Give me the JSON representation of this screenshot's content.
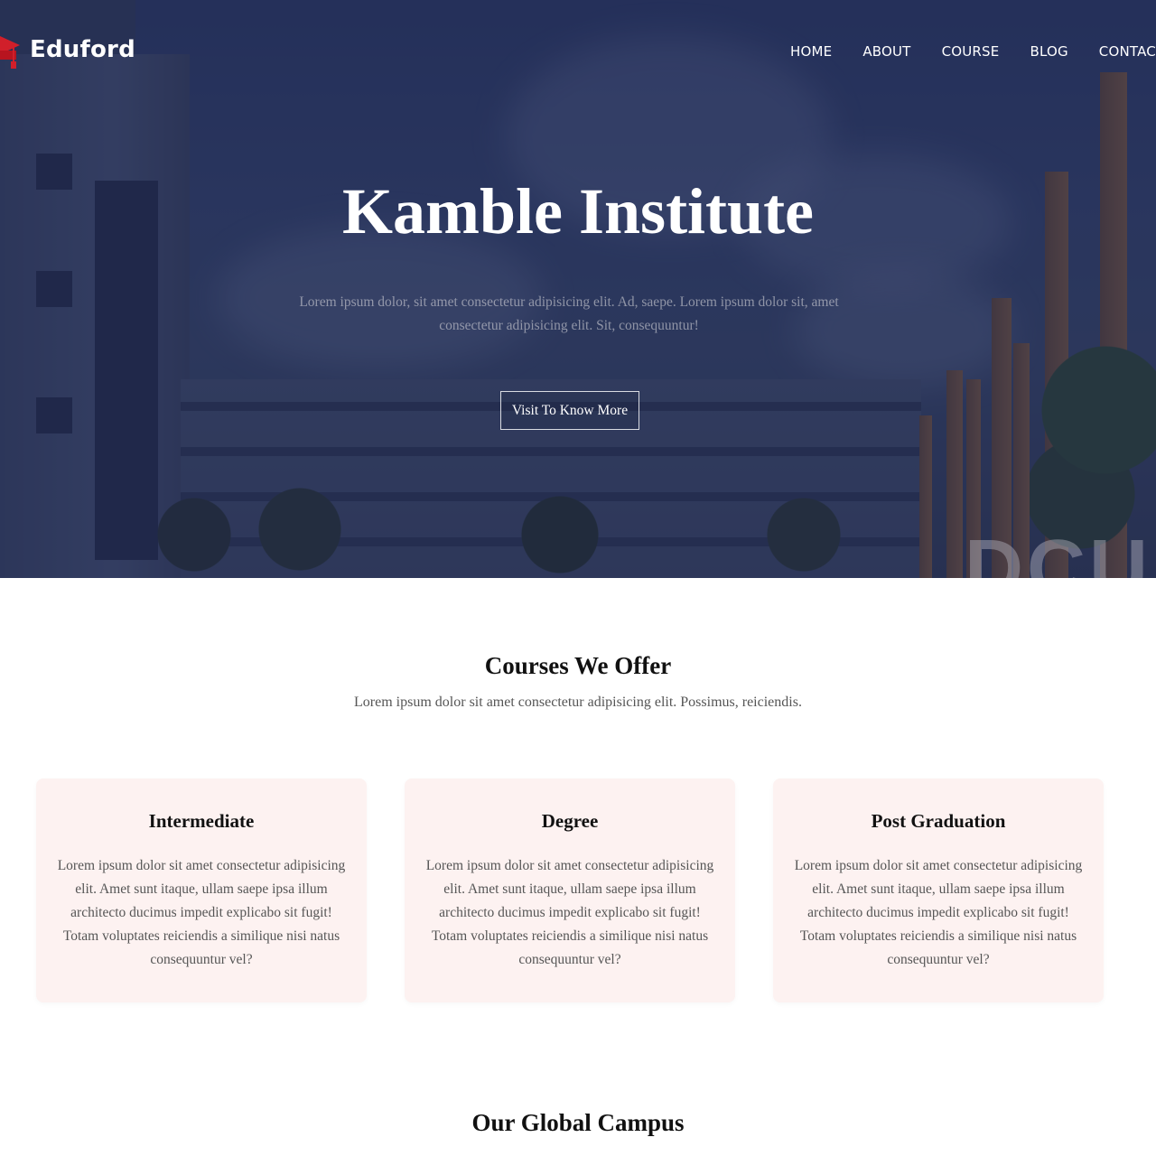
{
  "brand": {
    "name": "Eduford",
    "icon": "graduation-cap-icon",
    "icon_color": "#d11f2a"
  },
  "nav": {
    "items": [
      "HOME",
      "ABOUT",
      "COURSE",
      "BLOG",
      "CONTACT"
    ]
  },
  "hero": {
    "title": "Kamble Institute",
    "text": "Lorem ipsum dolor, sit amet consectetur adipisicing elit. Ad, saepe. Lorem ipsum dolor sit, amet consectetur adipisicing elit. Sit, consequuntur!",
    "button_label": "Visit To Know More",
    "overlay_color": "#202850"
  },
  "courses": {
    "title": "Courses We Offer",
    "subtitle": "Lorem ipsum dolor sit amet consectetur adipisicing elit. Possimus, reiciendis.",
    "card_bg": "#fdf2f1",
    "items": [
      {
        "title": "Intermediate",
        "text": "Lorem ipsum dolor sit amet consectetur adipisicing elit. Amet sunt itaque, ullam saepe ipsa illum architecto ducimus impedit explicabo sit fugit! Totam voluptates reiciendis a similique nisi natus consequuntur vel?"
      },
      {
        "title": "Degree",
        "text": "Lorem ipsum dolor sit amet consectetur adipisicing elit. Amet sunt itaque, ullam saepe ipsa illum architecto ducimus impedit explicabo sit fugit! Totam voluptates reiciendis a similique nisi natus consequuntur vel?"
      },
      {
        "title": "Post Graduation",
        "text": "Lorem ipsum dolor sit amet consectetur adipisicing elit. Amet sunt itaque, ullam saepe ipsa illum architecto ducimus impedit explicabo sit fugit! Totam voluptates reiciendis a similique nisi natus consequuntur vel?"
      }
    ]
  },
  "campus": {
    "title": "Our Global Campus"
  }
}
